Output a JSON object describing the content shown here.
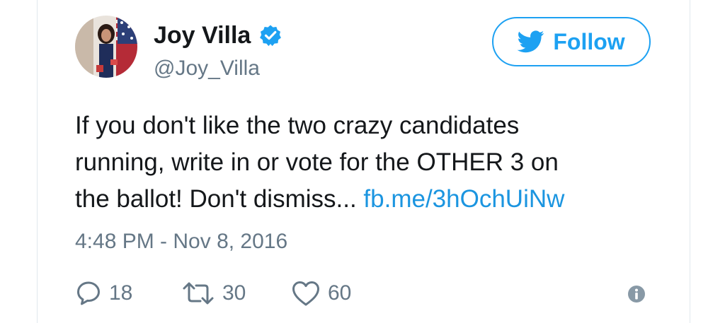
{
  "user": {
    "display_name": "Joy Villa",
    "handle": "@Joy_Villa",
    "verified": true
  },
  "follow_button": {
    "label": "Follow"
  },
  "tweet": {
    "lines": [
      "If you don't like the two crazy candidates",
      "running, write in or vote for the OTHER 3 on",
      "the ballot! Don't dismiss..."
    ],
    "link_text": "fb.me/3hOchUiNw",
    "timestamp": "4:48 PM - Nov 8, 2016"
  },
  "actions": {
    "replies": "18",
    "retweets": "30",
    "likes": "60"
  },
  "icons": {
    "reply": "reply-icon",
    "retweet": "retweet-icon",
    "like": "heart-icon",
    "info": "info-icon",
    "verified": "verified-badge-icon",
    "follow": "twitter-bird-icon"
  },
  "colors": {
    "brand_blue": "#1da1f2",
    "link_blue": "#1b95e0",
    "muted_gray": "#657786",
    "text_dark": "#14171a",
    "border": "#e1e8ed"
  }
}
